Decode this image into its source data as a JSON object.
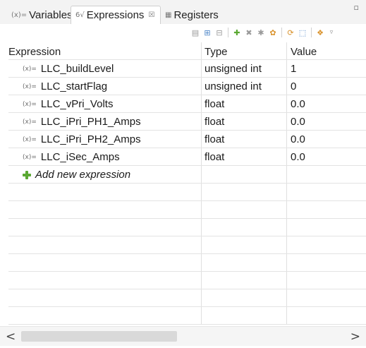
{
  "tabs": [
    {
      "label": "Variables",
      "icon": "(x)=",
      "active": false
    },
    {
      "label": "Expressions",
      "icon": "6√",
      "active": true,
      "close": "☒"
    },
    {
      "label": "Registers",
      "icon": "▦",
      "active": false
    }
  ],
  "view_menu_glyph": "▿",
  "toolbar": [
    "show-type-names",
    "show-logical-structure",
    "collapse-all",
    "add-expression",
    "remove-expression",
    "remove-all-expressions",
    "refresh",
    "continuous-refresh",
    "pin",
    "export",
    "view-menu"
  ],
  "columns": {
    "expression": "Expression",
    "type": "Type",
    "value": "Value"
  },
  "rows": [
    {
      "icon": "(x)=",
      "expression": "LLC_buildLevel",
      "type": "unsigned int",
      "value": "1"
    },
    {
      "icon": "(x)=",
      "expression": "LLC_startFlag",
      "type": "unsigned int",
      "value": "0"
    },
    {
      "icon": "(x)=",
      "expression": "LLC_vPri_Volts",
      "type": "float",
      "value": "0.0"
    },
    {
      "icon": "(x)=",
      "expression": "LLC_iPri_PH1_Amps",
      "type": "float",
      "value": "0.0"
    },
    {
      "icon": "(x)=",
      "expression": "LLC_iPri_PH2_Amps",
      "type": "float",
      "value": "0.0"
    },
    {
      "icon": "(x)=",
      "expression": "LLC_iSec_Amps",
      "type": "float",
      "value": "0.0"
    }
  ],
  "add_expression_label": "Add new expression",
  "scroll": {
    "left_arrow": "<",
    "right_arrow": ">",
    "thumb_fraction": 0.45
  },
  "colors": {
    "add_green": "#5aa832",
    "tab_active_bg": "#ffffff",
    "tabbar_bg": "#f3f3f3"
  }
}
